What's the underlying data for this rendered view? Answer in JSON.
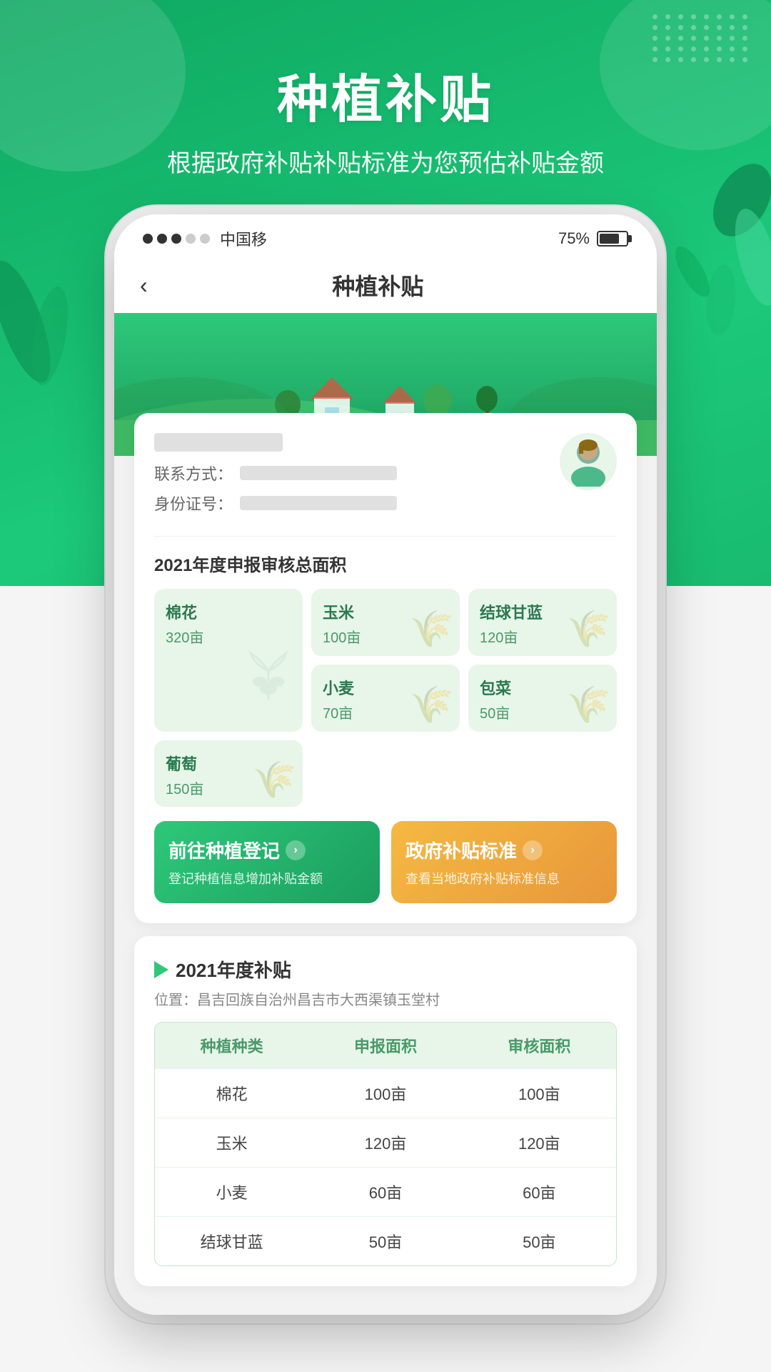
{
  "app": {
    "title": "种植补贴",
    "main_title": "种植补贴",
    "sub_title": "根据政府补贴补贴标准为您预估补贴金额"
  },
  "status_bar": {
    "carrier": "中国移",
    "battery_pct": "75%"
  },
  "navbar": {
    "back": "‹",
    "title": "种植补贴"
  },
  "user": {
    "contact_label": "联系方式：",
    "id_label": "身份证号："
  },
  "crop_section": {
    "title": "2021年度申报审核总面积",
    "crops": [
      {
        "name": "棉花",
        "area": "320亩",
        "large": true
      },
      {
        "name": "玉米",
        "area": "100亩",
        "large": false
      },
      {
        "name": "结球甘蓝",
        "area": "120亩",
        "large": false
      },
      {
        "name": "小麦",
        "area": "70亩",
        "large": false
      },
      {
        "name": "包菜",
        "area": "50亩",
        "large": false
      },
      {
        "name": "葡萄",
        "area": "150亩",
        "large": false
      }
    ]
  },
  "actions": {
    "register": {
      "title": "前往种植登记",
      "sub": "登记种植信息增加补贴金额",
      "arrow": "›"
    },
    "standard": {
      "title": "政府补贴标准",
      "sub": "查看当地政府补贴标准信息",
      "arrow": "›"
    }
  },
  "subsidy_section": {
    "title": "2021年度补贴",
    "location": "位置：昌吉回族自治州昌吉市大西渠镇玉堂村",
    "table": {
      "headers": [
        "种植种类",
        "申报面积",
        "审核面积"
      ],
      "rows": [
        {
          "crop": "棉花",
          "declared": "100亩",
          "reviewed": "100亩"
        },
        {
          "crop": "玉米",
          "declared": "120亩",
          "reviewed": "120亩"
        },
        {
          "crop": "小麦",
          "declared": "60亩",
          "reviewed": "60亩"
        },
        {
          "crop": "结球甘蓝",
          "declared": "50亩",
          "reviewed": "50亩"
        }
      ]
    }
  },
  "colors": {
    "primary_green": "#1cb870",
    "light_green": "#e8f5e9",
    "dark_green": "#1a9e5e",
    "orange": "#f5b942",
    "text_green": "#2a7a4f",
    "border_green": "#c8e6c9"
  }
}
